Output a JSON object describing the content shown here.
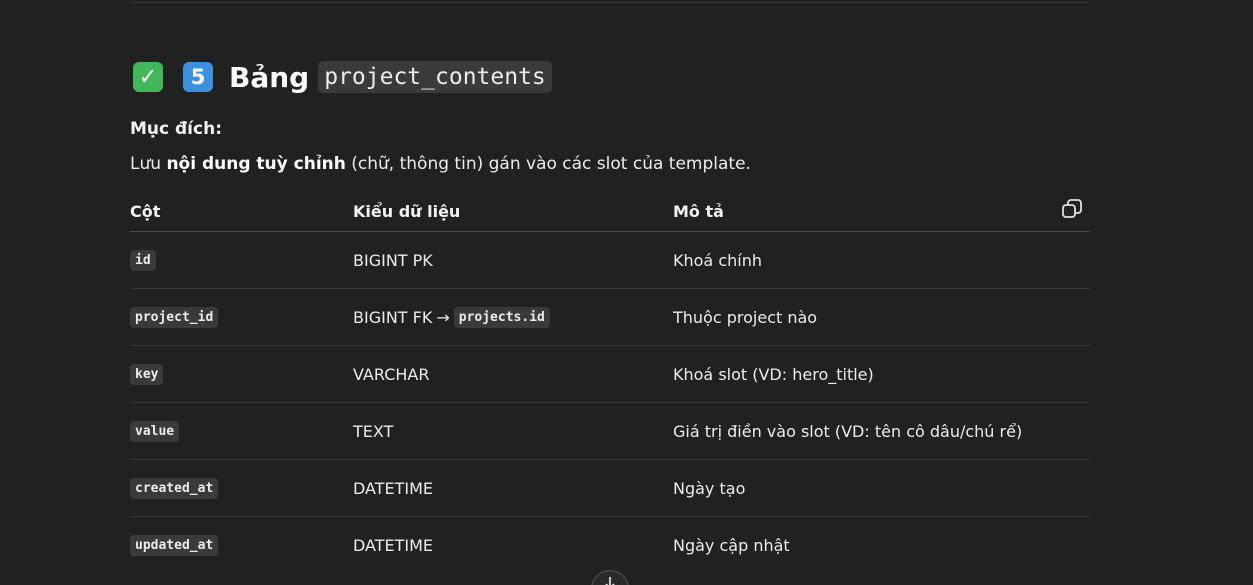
{
  "heading": {
    "check_emoji": "✓",
    "number_emoji": "5",
    "word": "Bảng",
    "table_name": "project_contents"
  },
  "purpose": {
    "label": "Mục đích:",
    "text_before": "Lưu ",
    "text_bold": "nội dung tuỳ chỉnh",
    "text_after": " (chữ, thông tin) gán vào các slot của template."
  },
  "table": {
    "headers": [
      "Cột",
      "Kiểu dữ liệu",
      "Mô tả"
    ],
    "rows": [
      {
        "column": "id",
        "type": "BIGINT PK",
        "type_ref": "",
        "description": "Khoá chính"
      },
      {
        "column": "project_id",
        "type": "BIGINT FK",
        "type_ref": "projects.id",
        "description": "Thuộc project nào"
      },
      {
        "column": "key",
        "type": "VARCHAR",
        "type_ref": "",
        "description": "Khoá slot (VD: hero_title)"
      },
      {
        "column": "value",
        "type": "TEXT",
        "type_ref": "",
        "description": "Giá trị điền vào slot (VD: tên cô dâu/chú rể)"
      },
      {
        "column": "created_at",
        "type": "DATETIME",
        "type_ref": "",
        "description": "Ngày tạo"
      },
      {
        "column": "updated_at",
        "type": "DATETIME",
        "type_ref": "",
        "description": "Ngày cập nhật"
      }
    ],
    "arrow": "→"
  },
  "icons": {
    "copy": "copy-icon",
    "scroll_down": "arrow-down-icon"
  },
  "colors": {
    "background": "#212121",
    "code_background": "#3a3a3a",
    "check_emoji": "#43b85a",
    "number_emoji": "#3d8fe0"
  }
}
